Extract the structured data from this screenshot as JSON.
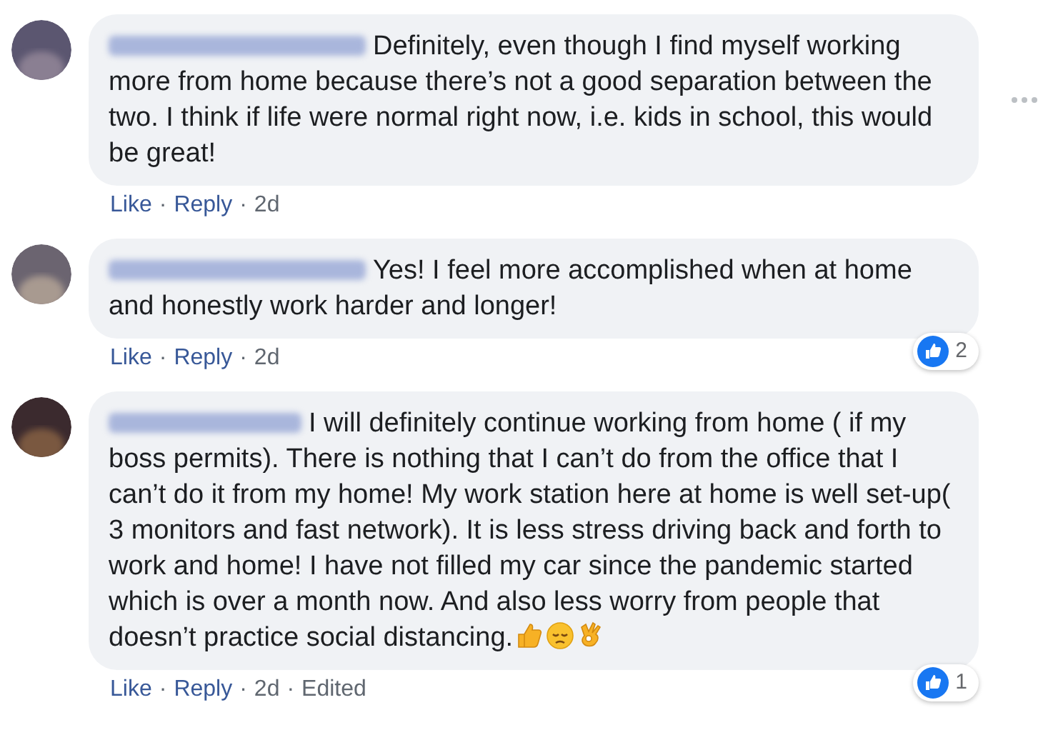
{
  "comments": [
    {
      "text": "Definitely, even though I find myself working more from home because there’s not a good separation between the two. I think if life were normal right now, i.e. kids in school, this would be great!",
      "actions": [
        "Like",
        "·",
        "Reply",
        "·",
        "2d"
      ],
      "show_more": true
    },
    {
      "text": "Yes! I feel more accomplished when at home and honestly work harder and longer!",
      "actions": [
        "Like",
        "·",
        "Reply",
        "·",
        "2d"
      ],
      "reaction_count": "2"
    },
    {
      "text": "I will definitely continue working from home ( if my boss permits). There is nothing that I can’t do from the office that I can’t do it from my home! My work station here at home is well set-up( 3 monitors and fast network). It is less stress driving back and forth to work and home! I have not filled my car since the pandemic started which is over a month now. And also less worry from people that doesn’t practice social distancing.",
      "ends_with_emojis": true,
      "actions": [
        "Like",
        "·",
        "Reply",
        "·",
        "2d",
        "·",
        "Edited"
      ],
      "reaction_count": "1"
    }
  ]
}
